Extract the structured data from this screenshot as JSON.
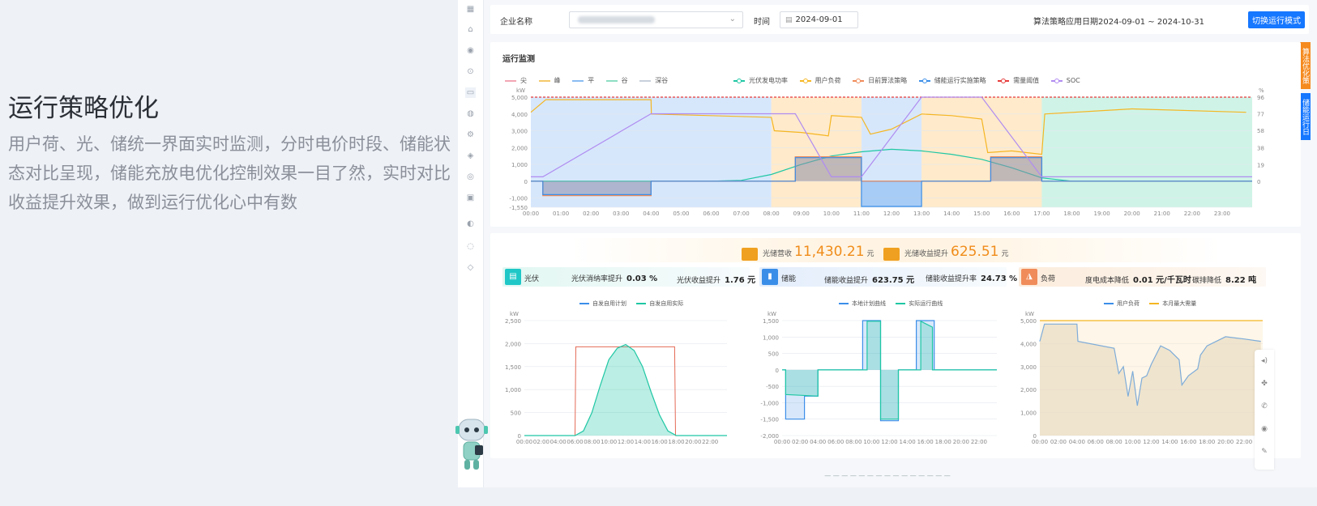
{
  "intro": {
    "title": "运行策略优化",
    "description": "用户荷、光、储统一界面实时监测，分时电价时段、储能状态对比呈现，储能充放电优化控制效果一目了然，实时对比收益提升效果，做到运行优化心中有数"
  },
  "topbar": {
    "company_label": "企业名称",
    "time_label": "时间",
    "date_value": "2024-09-01",
    "strategy_info": "算法策略应用日期2024-09-01 ~ 2024-10-31",
    "switch_button": "切换运行模式"
  },
  "monitor": {
    "title": "运行监测",
    "unit_left": "kW",
    "unit_right": "%",
    "price_legend": [
      "尖",
      "峰",
      "平",
      "谷",
      "深谷"
    ],
    "series_legend": [
      "光伏发电功率",
      "用户负荷",
      "日前算法策略",
      "储能运行实施策略",
      "需量阈值",
      "SOC"
    ],
    "side_tab_1": "算法优化策略",
    "side_tab_2": "储能运行日志"
  },
  "summary": {
    "pv_revenue_label": "光储营收",
    "pv_revenue_value": "11,430.21",
    "pv_revenue_unit": "元",
    "gain_label": "光储收益提升",
    "gain_value": "625.51",
    "gain_unit": "元"
  },
  "cards": [
    {
      "name": "光伏",
      "k1": "光伏消纳率提升",
      "v1": "0.03 %",
      "k2": "光伏收益提升",
      "v2": "1.76 元"
    },
    {
      "name": "储能",
      "k1": "储能收益提升",
      "v1": "623.75 元",
      "k2": "储能收益提升率",
      "v2": "24.73 %"
    },
    {
      "name": "负荷",
      "k1": "度电成本降低",
      "v1": "0.01 元/千瓦时",
      "k2": "碳排降低",
      "v2": "8.22 吨"
    }
  ],
  "mini_charts": {
    "pv_legend": [
      "自发自用计划",
      "自发自用实际"
    ],
    "storage_legend": [
      "本地计划曲线",
      "实际运行曲线"
    ],
    "load_legend": [
      "用户负荷",
      "本月最大需量"
    ],
    "unit": "kW"
  },
  "colors": {
    "peak": "#ffe6c2",
    "flat": "#cfe3fb",
    "valley": "#c7f2e3",
    "pv": "#1fc7a4",
    "load": "#f5b622",
    "soc": "#b08cf0",
    "demand": "#e63b3b",
    "storage": "#3b8ee8",
    "plan": "#f08c5a",
    "accent": "#1677ff"
  },
  "chart_data": [
    {
      "type": "line",
      "title": "运行监测",
      "xlabel": "",
      "ylabel": "kW",
      "ylabel_right": "%",
      "ylim": [
        -1550,
        5000
      ],
      "y_ticks": [
        "5,000",
        "4,000",
        "3,000",
        "2,000",
        "1,000",
        "0",
        "-1,000",
        "-1,550"
      ],
      "y2_ticks": [
        "96",
        "77",
        "58",
        "38",
        "19",
        "0"
      ],
      "x_ticks": [
        "00:00",
        "01:00",
        "02:00",
        "03:00",
        "04:00",
        "05:00",
        "06:00",
        "07:00",
        "08:00",
        "09:00",
        "10:00",
        "11:00",
        "12:00",
        "13:00",
        "14:00",
        "15:00",
        "16:00",
        "17:00",
        "18:00",
        "19:00",
        "20:00",
        "21:00",
        "22:00",
        "23:00"
      ],
      "bands": [
        {
          "from": 0,
          "to": 8,
          "kind": "flat"
        },
        {
          "from": 8,
          "to": 11,
          "kind": "peak"
        },
        {
          "from": 11,
          "to": 13,
          "kind": "flat"
        },
        {
          "from": 13,
          "to": 17,
          "kind": "peak"
        },
        {
          "from": 17,
          "to": 24,
          "kind": "valley"
        }
      ],
      "series": [
        {
          "name": "光伏发电功率",
          "x": [
            0,
            6,
            7,
            8,
            9,
            10,
            11,
            12,
            13,
            14,
            15,
            16,
            17,
            18,
            24
          ],
          "values": [
            0,
            0,
            50,
            400,
            1000,
            1500,
            1750,
            1900,
            1800,
            1600,
            1300,
            800,
            200,
            0,
            0
          ]
        },
        {
          "name": "用户负荷",
          "x": [
            0,
            0.5,
            4,
            4.01,
            8,
            8.1,
            9,
            9.9,
            10,
            11,
            11.3,
            12,
            13,
            14,
            15,
            15.2,
            16,
            17,
            17.1,
            20,
            23.8
          ],
          "values": [
            4100,
            4850,
            4850,
            4000,
            3800,
            3000,
            2900,
            2700,
            3900,
            3800,
            2800,
            3100,
            4000,
            3900,
            3700,
            1700,
            1800,
            1600,
            4000,
            4300,
            4100
          ]
        },
        {
          "name": "日前算法策略",
          "x": [
            0,
            0.4,
            0.4,
            4,
            4,
            8.8,
            8.8,
            11,
            11,
            13,
            13,
            15.3,
            15.3,
            17,
            17,
            24
          ],
          "values": [
            0,
            0,
            -850,
            -850,
            0,
            0,
            1450,
            1450,
            0,
            0,
            0,
            0,
            1450,
            1450,
            0,
            0
          ]
        },
        {
          "name": "储能运行实施策略",
          "x": [
            0,
            0.4,
            0.4,
            4,
            4,
            8.8,
            8.8,
            10.4,
            10.4,
            11,
            11,
            13,
            13,
            15.3,
            15.3,
            17,
            17,
            24
          ],
          "values": [
            0,
            0,
            -800,
            -800,
            0,
            0,
            1400,
            1400,
            1400,
            1400,
            -1500,
            -1500,
            0,
            0,
            1400,
            1400,
            0,
            0
          ]
        },
        {
          "name": "需量阈值",
          "x": [
            0,
            24
          ],
          "values": [
            5000,
            5000
          ]
        },
        {
          "name": "SOC",
          "x": [
            0,
            0.4,
            4,
            8.8,
            10,
            11,
            13,
            15,
            17,
            24
          ],
          "values_pct": [
            5,
            5,
            77,
            77,
            5,
            5,
            96,
            96,
            5,
            5
          ]
        }
      ]
    },
    {
      "type": "area",
      "ylabel": "kW",
      "ylim": [
        0,
        2500
      ],
      "y_ticks": [
        "2,500",
        "2,000",
        "1,500",
        "1,000",
        "500",
        "0"
      ],
      "x_ticks": [
        "00:00",
        "02:00",
        "04:00",
        "06:00",
        "08:00",
        "10:00",
        "12:00",
        "14:00",
        "16:00",
        "18:00",
        "20:00",
        "22:00"
      ],
      "series": [
        {
          "name": "自发自用计划",
          "x": [
            0,
            6,
            6.1,
            17.8,
            17.9,
            24
          ],
          "values": [
            0,
            0,
            1930,
            1930,
            0,
            0
          ]
        },
        {
          "name": "自发自用实际",
          "x": [
            0,
            6,
            7,
            8,
            9,
            10,
            11,
            12,
            13,
            14,
            15,
            16,
            17,
            18,
            24
          ],
          "values": [
            0,
            0,
            100,
            500,
            1100,
            1650,
            1900,
            1980,
            1850,
            1500,
            950,
            450,
            100,
            0,
            0
          ]
        }
      ]
    },
    {
      "type": "area",
      "ylabel": "kW",
      "ylim": [
        -2000,
        1500
      ],
      "y_ticks": [
        "1,500",
        "1,000",
        "500",
        "0",
        "-500",
        "-1,000",
        "-1,500",
        "-2,000"
      ],
      "x_ticks": [
        "00:00",
        "02:00",
        "04:00",
        "06:00",
        "08:00",
        "10:00",
        "12:00",
        "14:00",
        "16:00",
        "18:00",
        "20:00",
        "22:00"
      ],
      "series": [
        {
          "name": "本地计划曲线",
          "x": [
            0,
            0.4,
            0.4,
            2.5,
            2.5,
            4,
            4,
            9,
            9,
            11,
            11,
            13,
            13,
            15,
            15,
            17,
            17,
            24
          ],
          "values": [
            0,
            0,
            -1500,
            -1500,
            -800,
            -800,
            0,
            0,
            1500,
            1500,
            -1550,
            -1550,
            0,
            0,
            1500,
            1500,
            0,
            0
          ]
        },
        {
          "name": "实际运行曲线",
          "x": [
            0,
            0.4,
            0.4,
            4,
            4,
            9.5,
            9.5,
            11,
            11,
            13,
            13,
            15.5,
            15.5,
            16.8,
            16.8,
            24
          ],
          "values": [
            0,
            0,
            -750,
            -800,
            0,
            0,
            1480,
            1480,
            -1500,
            -1500,
            0,
            0,
            1480,
            1300,
            0,
            0
          ]
        }
      ]
    },
    {
      "type": "line",
      "ylabel": "kW",
      "ylim": [
        0,
        5000
      ],
      "y_ticks": [
        "5,000",
        "4,000",
        "3,000",
        "2,000",
        "1,000",
        "0"
      ],
      "x_ticks": [
        "00:00",
        "02:00",
        "04:00",
        "06:00",
        "08:00",
        "10:00",
        "12:00",
        "14:00",
        "16:00",
        "18:00",
        "20:00",
        "22:00"
      ],
      "series": [
        {
          "name": "用户负荷",
          "x": [
            0,
            0.5,
            4,
            4.1,
            8,
            8.5,
            9,
            9.5,
            10,
            10.5,
            11,
            11.5,
            12,
            13,
            14,
            15,
            15.3,
            16,
            17,
            17.3,
            18,
            20,
            22,
            23.8
          ],
          "values": [
            4100,
            4850,
            4850,
            4100,
            3800,
            2700,
            3000,
            1700,
            2800,
            1300,
            2500,
            2600,
            3100,
            3900,
            3700,
            3300,
            2200,
            2600,
            2900,
            3500,
            3900,
            4300,
            4200,
            4100
          ]
        },
        {
          "name": "本月最大需量",
          "x": [
            0,
            24
          ],
          "values": [
            5000,
            5000
          ]
        }
      ]
    }
  ]
}
